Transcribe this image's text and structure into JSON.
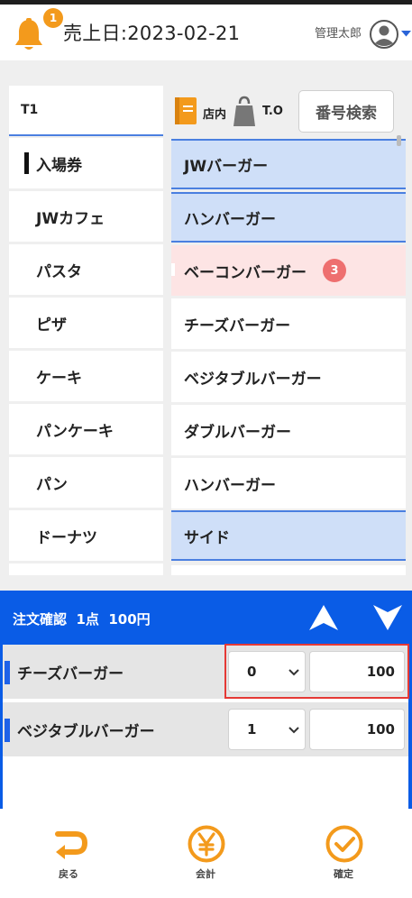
{
  "header": {
    "notification_count": "1",
    "sales_date": "売上日:2023-02-21",
    "user_name": "管理太郎"
  },
  "table": {
    "label": "T1"
  },
  "categories": [
    {
      "label": "入場券",
      "active": true
    },
    {
      "label": "JWカフェ"
    },
    {
      "label": "パスタ"
    },
    {
      "label": "ピザ"
    },
    {
      "label": "ケーキ"
    },
    {
      "label": "パンケーキ"
    },
    {
      "label": "パン"
    },
    {
      "label": "ドーナツ"
    }
  ],
  "toolbar": {
    "dine_in": "店内",
    "takeout": "T.O",
    "number_search": "番号検索"
  },
  "products": [
    {
      "label": "JWバーガー",
      "style": "group"
    },
    {
      "label": "ハンバーガー",
      "style": "group"
    },
    {
      "label": "ベーコンバーガー",
      "style": "selected",
      "badge": "3"
    },
    {
      "label": "チーズバーガー"
    },
    {
      "label": "ベジタブルバーガー"
    },
    {
      "label": "ダブルバーガー"
    },
    {
      "label": "ハンバーガー"
    },
    {
      "label": "サイド",
      "style": "group"
    }
  ],
  "order_summary": {
    "title": "注文確認",
    "count": "1点",
    "total": "100円"
  },
  "order_lines": [
    {
      "name": "チーズバーガー",
      "qty": "0",
      "price": "100"
    },
    {
      "name": "ベジタブルバーガー",
      "qty": "1",
      "price": "100"
    }
  ],
  "footer": {
    "back": "戻る",
    "checkout": "会計",
    "confirm": "確定"
  },
  "colors": {
    "accent_blue": "#0a5ce6",
    "item_blue": "#cfdff8",
    "item_pink": "#fde4e4",
    "badge_orange": "#f39a1c",
    "badge_red": "#ee6f6f",
    "highlight_red": "#e53935"
  },
  "icons": {
    "notification": "bell-icon",
    "user": "user-avatar-icon",
    "dine_in": "book-icon",
    "takeout": "bag-icon",
    "back": "return-arrow-icon",
    "checkout": "yen-icon",
    "confirm": "check-circle-icon"
  }
}
